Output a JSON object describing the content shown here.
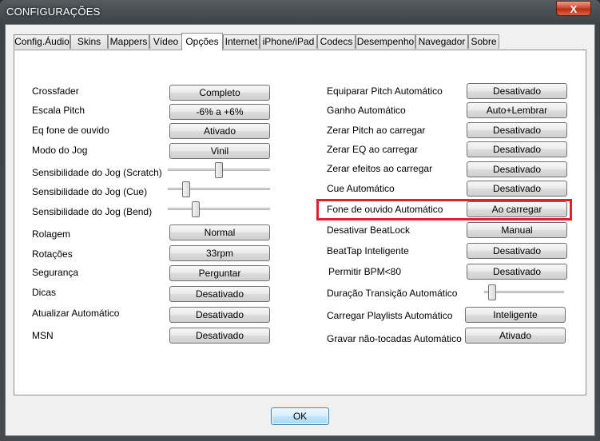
{
  "window": {
    "title": "CONFIGURAÇÕES",
    "close_label": "X"
  },
  "tabs": [
    {
      "label": "Config.Áudio"
    },
    {
      "label": "Skins"
    },
    {
      "label": "Mappers"
    },
    {
      "label": "Vídeo"
    },
    {
      "label": "Opções",
      "active": true
    },
    {
      "label": "Internet"
    },
    {
      "label": "iPhone/iPad"
    },
    {
      "label": "Codecs"
    },
    {
      "label": "Desempenho"
    },
    {
      "label": "Navegador"
    },
    {
      "label": "Sobre"
    }
  ],
  "left": {
    "crossfader": {
      "label": "Crossfader",
      "value": "Completo"
    },
    "escala_pitch": {
      "label": "Escala Pitch",
      "value": "-6% a +6%"
    },
    "eq_fone": {
      "label": "Eq fone de ouvido",
      "value": "Ativado"
    },
    "modo_jog": {
      "label": "Modo do Jog",
      "value": "Vinil"
    },
    "sens_scratch": {
      "label": "Sensibilidade do Jog (Scratch)",
      "level": 0.5
    },
    "sens_cue": {
      "label": "Sensibilidade do Jog (Cue)",
      "level": 0.15
    },
    "sens_bend": {
      "label": "Sensibilidade do Jog (Bend)",
      "level": 0.25
    },
    "rolagem": {
      "label": "Rolagem",
      "value": "Normal"
    },
    "rotacoes": {
      "label": "Rotações",
      "value": "33rpm"
    },
    "seguranca": {
      "label": "Segurança",
      "value": "Perguntar"
    },
    "dicas": {
      "label": "Dicas",
      "value": "Desativado"
    },
    "atualizar": {
      "label": "Atualizar Automático",
      "value": "Desativado"
    },
    "msn": {
      "label": "MSN",
      "value": "Desativado"
    }
  },
  "right": {
    "equiparar_pitch": {
      "label": "Equiparar Pitch Automático",
      "value": "Desativado"
    },
    "ganho": {
      "label": "Ganho Automático",
      "value": "Auto+Lembrar"
    },
    "zerar_pitch": {
      "label": "Zerar Pitch ao carregar",
      "value": "Desativado"
    },
    "zerar_eq": {
      "label": "Zerar EQ ao carregar",
      "value": "Desativado"
    },
    "zerar_efeitos": {
      "label": "Zerar efeitos ao carregar",
      "value": "Desativado"
    },
    "cue_auto": {
      "label": "Cue Automático",
      "value": "Desativado"
    },
    "fone_auto": {
      "label": "Fone de ouvido Automático",
      "value": "Ao carregar"
    },
    "beatlock": {
      "label": "Desativar BeatLock",
      "value": "Manual"
    },
    "beattap": {
      "label": "BeatTap Inteligente",
      "value": "Desativado"
    },
    "bpm80": {
      "label": "Permitir BPM<80",
      "value": "Desativado"
    },
    "duracao": {
      "label": "Duração Transição Automático",
      "level": 0.05
    },
    "playlists": {
      "label": "Carregar Playlists Automático",
      "value": "Inteligente"
    },
    "gravar": {
      "label": "Gravar não-tocadas Automático",
      "value": "Ativado"
    }
  },
  "footer": {
    "ok_label": "OK"
  },
  "colors": {
    "highlight": "#e0202a",
    "ok_border": "#3c7fb1"
  }
}
